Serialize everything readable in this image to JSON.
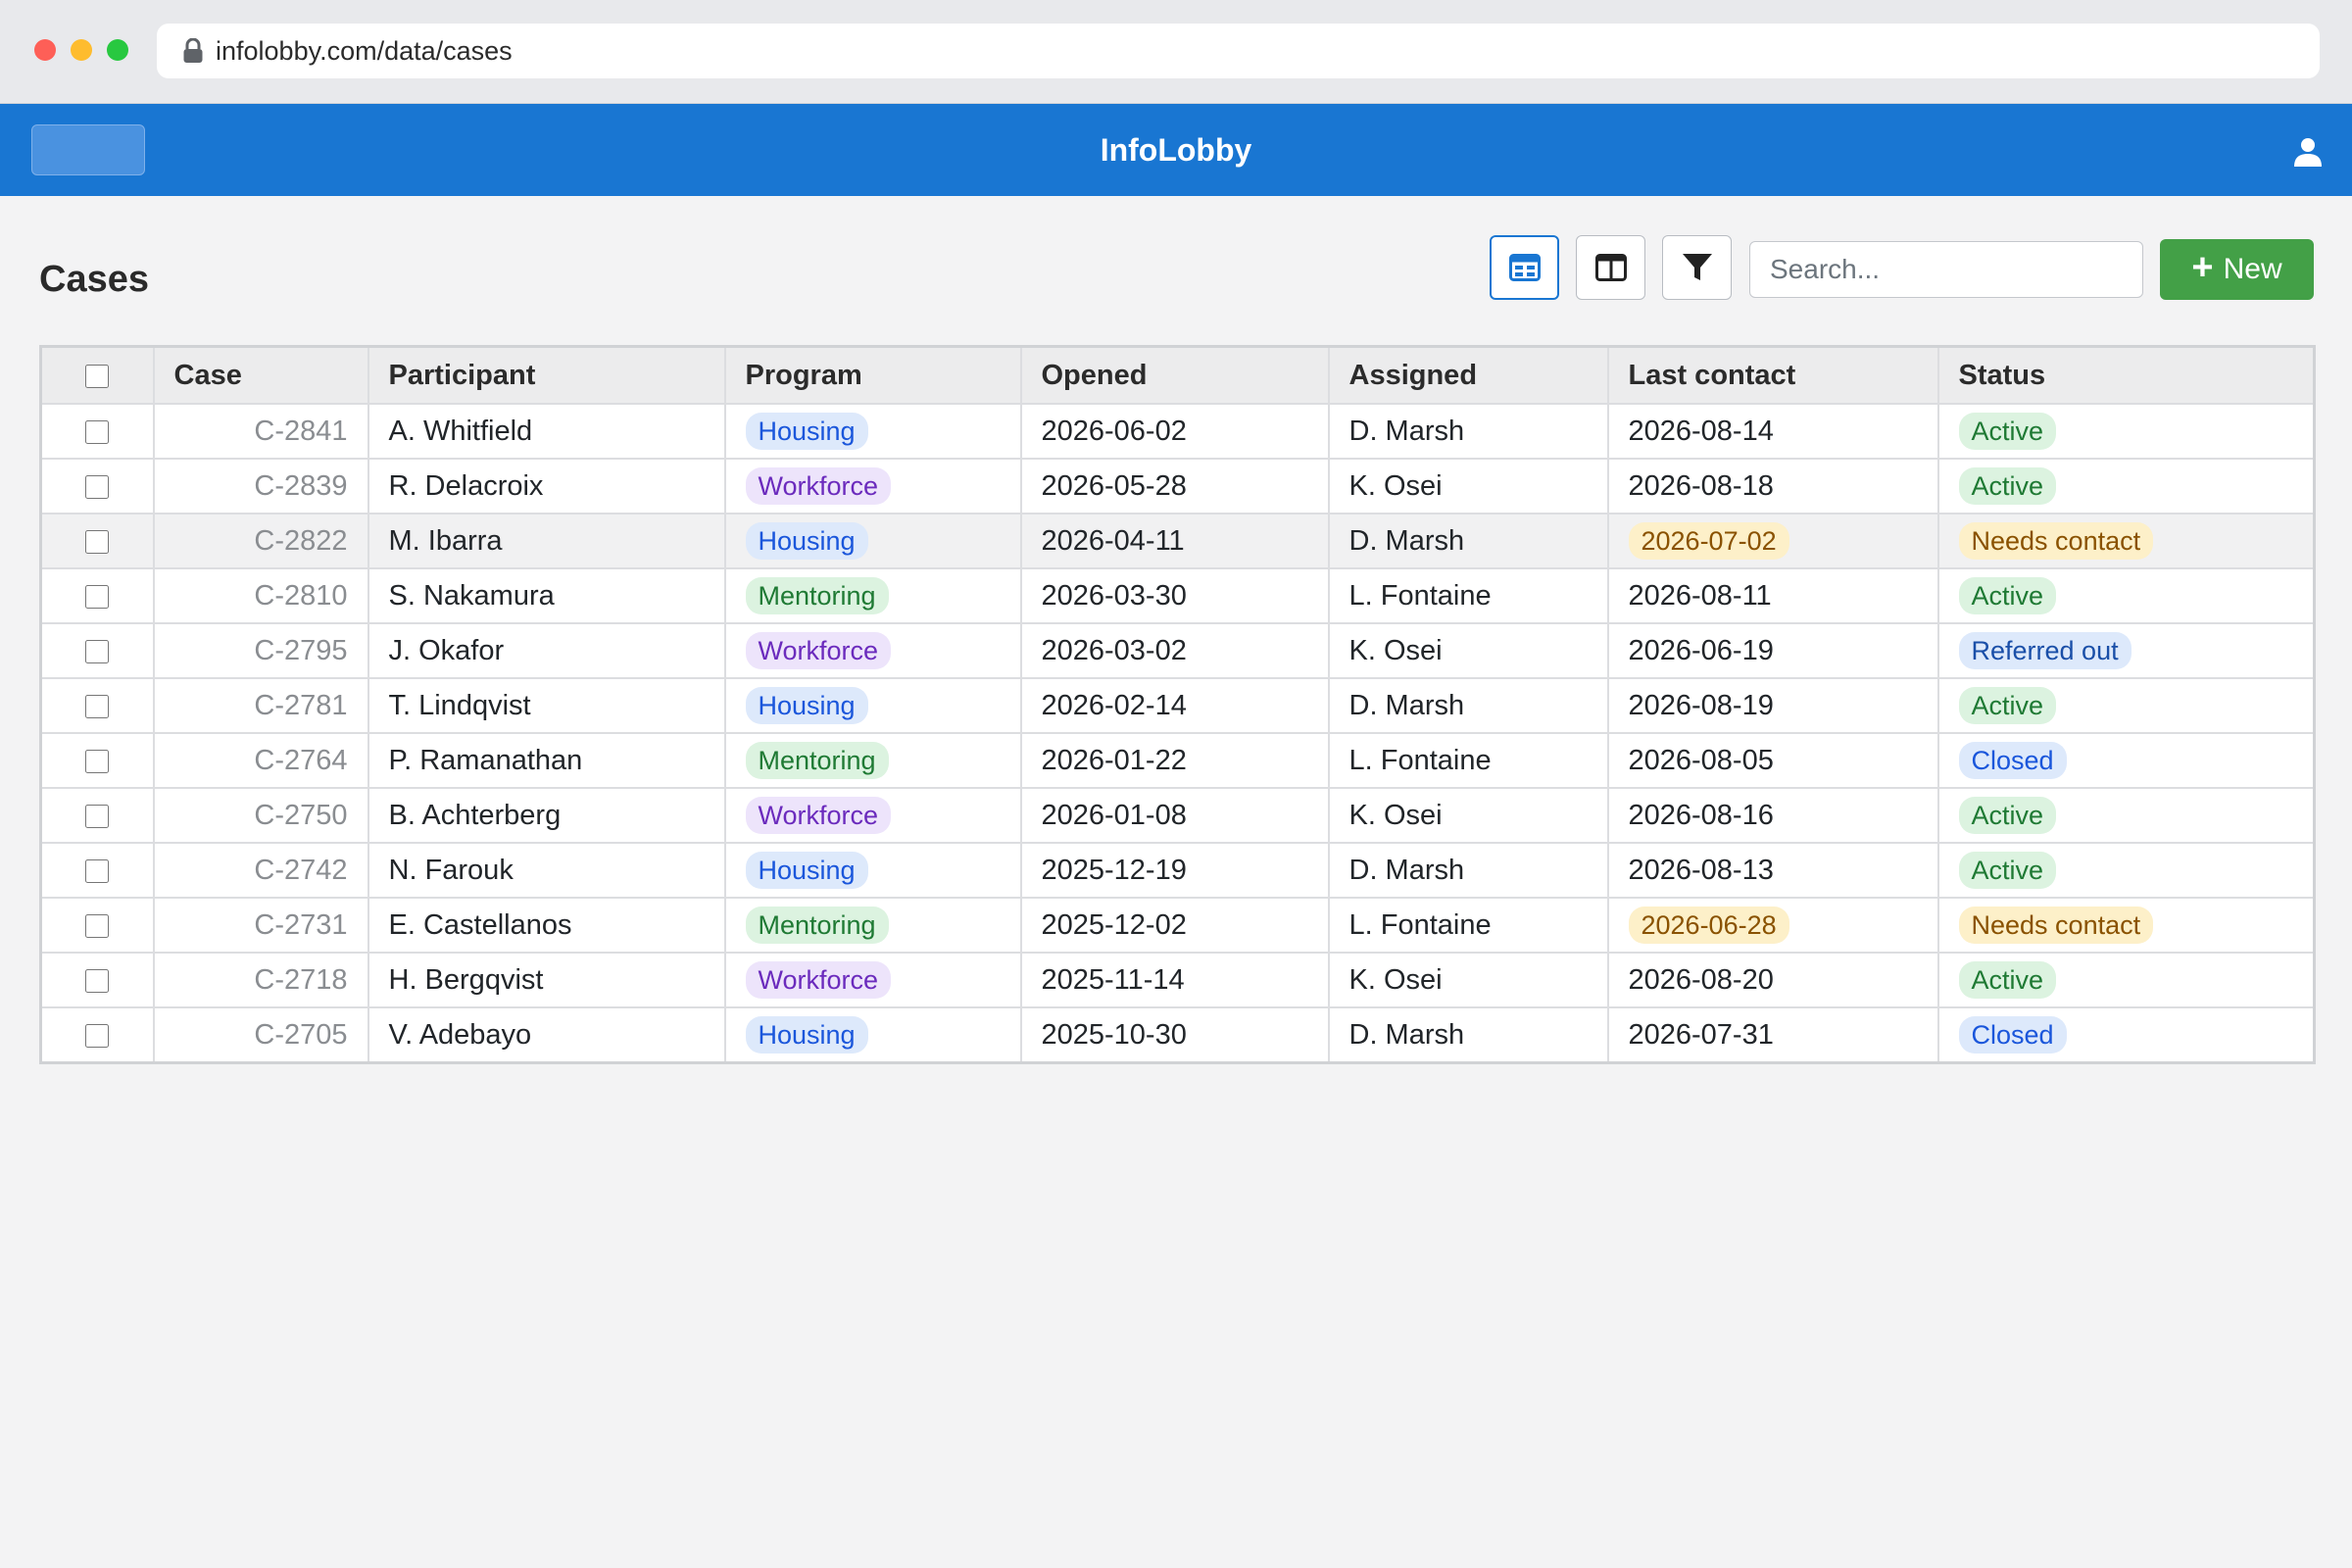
{
  "browser": {
    "url": "infolobby.com/data/cases"
  },
  "app": {
    "title": "InfoLobby"
  },
  "page": {
    "title": "Cases"
  },
  "toolbar": {
    "search_placeholder": "Search...",
    "new_label": "New"
  },
  "colors": {
    "accent": "#1976d2",
    "new_button": "#43a047"
  },
  "table": {
    "columns": [
      "Case",
      "Participant",
      "Program",
      "Opened",
      "Assigned",
      "Last contact",
      "Status"
    ],
    "rows": [
      {
        "case": "C-2841",
        "participant": "A. Whitfield",
        "program": "Housing",
        "opened": "2026-06-02",
        "assigned": "D. Marsh",
        "last_contact": "2026-08-14",
        "status": "Active"
      },
      {
        "case": "C-2839",
        "participant": "R. Delacroix",
        "program": "Workforce",
        "opened": "2026-05-28",
        "assigned": "K. Osei",
        "last_contact": "2026-08-18",
        "status": "Active"
      },
      {
        "case": "C-2822",
        "participant": "M. Ibarra",
        "program": "Housing",
        "opened": "2026-04-11",
        "assigned": "D. Marsh",
        "last_contact": "2026-07-02",
        "status": "Needs contact"
      },
      {
        "case": "C-2810",
        "participant": "S. Nakamura",
        "program": "Mentoring",
        "opened": "2026-03-30",
        "assigned": "L. Fontaine",
        "last_contact": "2026-08-11",
        "status": "Active"
      },
      {
        "case": "C-2795",
        "participant": "J. Okafor",
        "program": "Workforce",
        "opened": "2026-03-02",
        "assigned": "K. Osei",
        "last_contact": "2026-06-19",
        "status": "Referred out"
      },
      {
        "case": "C-2781",
        "participant": "T. Lindqvist",
        "program": "Housing",
        "opened": "2026-02-14",
        "assigned": "D. Marsh",
        "last_contact": "2026-08-19",
        "status": "Active"
      },
      {
        "case": "C-2764",
        "participant": "P. Ramanathan",
        "program": "Mentoring",
        "opened": "2026-01-22",
        "assigned": "L. Fontaine",
        "last_contact": "2026-08-05",
        "status": "Closed"
      },
      {
        "case": "C-2750",
        "participant": "B. Achterberg",
        "program": "Workforce",
        "opened": "2026-01-08",
        "assigned": "K. Osei",
        "last_contact": "2026-08-16",
        "status": "Active"
      },
      {
        "case": "C-2742",
        "participant": "N. Farouk",
        "program": "Housing",
        "opened": "2025-12-19",
        "assigned": "D. Marsh",
        "last_contact": "2026-08-13",
        "status": "Active"
      },
      {
        "case": "C-2731",
        "participant": "E. Castellanos",
        "program": "Mentoring",
        "opened": "2025-12-02",
        "assigned": "L. Fontaine",
        "last_contact": "2026-06-28",
        "status": "Needs contact"
      },
      {
        "case": "C-2718",
        "participant": "H. Bergqvist",
        "program": "Workforce",
        "opened": "2025-11-14",
        "assigned": "K. Osei",
        "last_contact": "2026-08-20",
        "status": "Active"
      },
      {
        "case": "C-2705",
        "participant": "V. Adebayo",
        "program": "Housing",
        "opened": "2025-10-30",
        "assigned": "D. Marsh",
        "last_contact": "2026-07-31",
        "status": "Closed"
      }
    ]
  }
}
